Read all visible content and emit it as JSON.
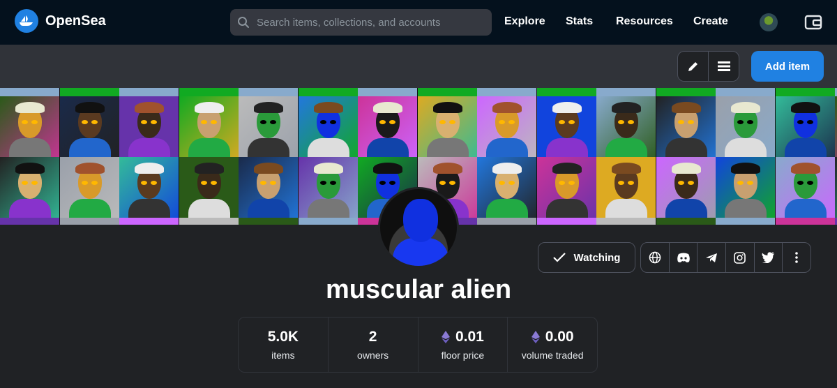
{
  "nav": {
    "brand": "OpenSea",
    "search_placeholder": "Search items, collections, and accounts",
    "links": [
      "Explore",
      "Stats",
      "Resources",
      "Create"
    ]
  },
  "toolbar": {
    "add_item_label": "Add item"
  },
  "collection": {
    "name": "muscular alien",
    "watch_label": "Watching"
  },
  "stats": [
    {
      "value": "5.0K",
      "label": "items",
      "eth": false
    },
    {
      "value": "2",
      "label": "owners",
      "eth": false
    },
    {
      "value": "0.01",
      "label": "floor price",
      "eth": true
    },
    {
      "value": "0.00",
      "label": "volume traded",
      "eth": true
    }
  ],
  "icons": {
    "edit": "pencil-icon",
    "list": "list-icon",
    "website": "globe-icon",
    "discord": "discord-icon",
    "telegram": "telegram-icon",
    "instagram": "instagram-icon",
    "twitter": "twitter-icon",
    "more": "more-vertical-icon",
    "eth": "ethereum-icon"
  },
  "colors": {
    "accent": "#2081e2",
    "nav_bg": "#04111d",
    "page_bg": "#202225",
    "eth": "#8a7ad4"
  }
}
